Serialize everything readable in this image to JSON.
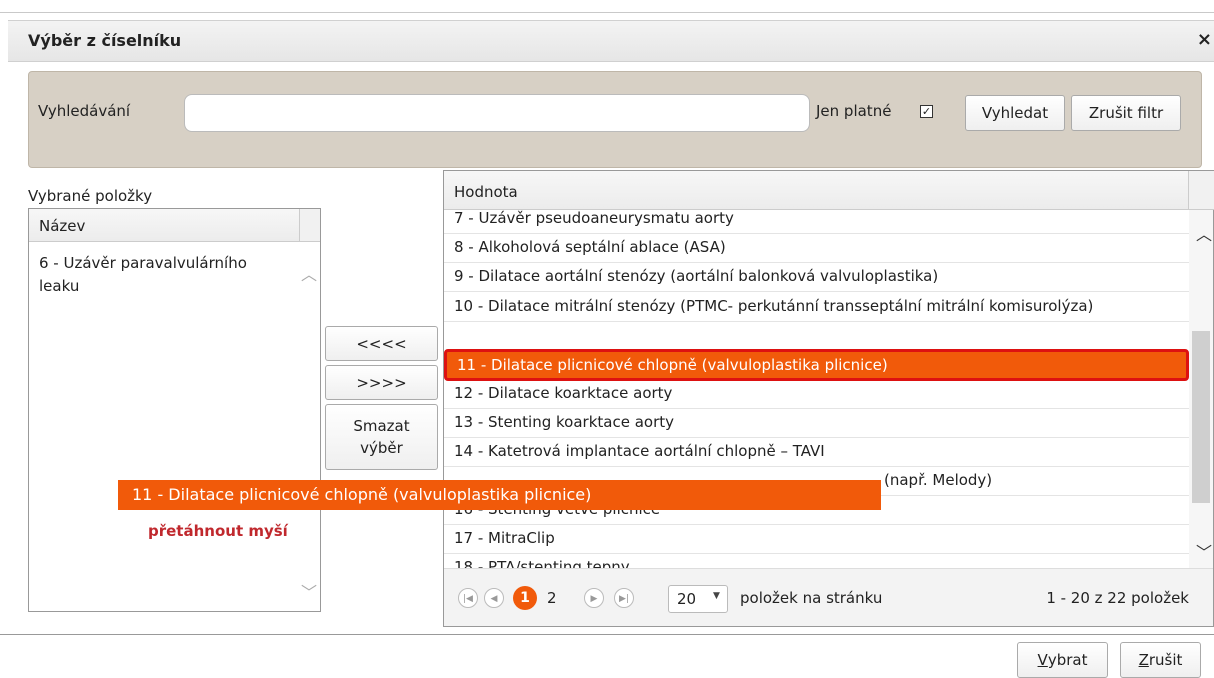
{
  "dialog": {
    "title": "Výběr z číselníku",
    "close_symbol": "×"
  },
  "search": {
    "label": "Vyhledávání",
    "value": "",
    "placeholder": "",
    "only_valid_label": "Jen platné",
    "only_valid_checked": true,
    "search_button": "Vyhledat",
    "clear_filter_button": "Zrušit filtr"
  },
  "selected": {
    "label": "Vybrané položky",
    "column_header": "Název",
    "items": [
      "6 - Uzávěr paravalvulárního leaku"
    ]
  },
  "transfer": {
    "move_left": "<<<<",
    "move_right": ">>>>",
    "clear_selection_line1": "Smazat",
    "clear_selection_line2": "výběr"
  },
  "list": {
    "column_header": "Hodnota",
    "rows": [
      "7 - Uzávěr pseudoaneurysmatu aorty",
      "8 - Alkoholová septální ablace (ASA)",
      "9 - Dilatace aortální stenózy (aortální balonková valvuloplastika)",
      "10 - Dilatace mitrální stenózy (PTMC- perkutánní transseptální mitrální komisurolýza)",
      "11 - Dilatace plicnicové chlopně (valvuloplastika plicnice)",
      "12 - Dilatace koarktace aorty",
      "13 - Stenting koarktace aorty",
      "14 - Katetrová implantace aortální chlopně – TAVI",
      "(např. Melody)",
      "16 - Stenting větve plicnice",
      "17 - MitraClip",
      "18 - PTA/stenting tepny"
    ],
    "highlighted_index": 4
  },
  "drag": {
    "ghost_text": "11 - Dilatace plicnicové chlopně (valvuloplastika plicnice)",
    "hint": "přetáhnout myší"
  },
  "pager": {
    "pages": [
      "1",
      "2"
    ],
    "current_page": "1",
    "page_size": "20",
    "items_per_page_label": "položek na stránku",
    "count_text": "1 - 20 z 22 položek",
    "icons": [
      "first-page-icon",
      "prev-page-icon",
      "next-page-icon",
      "last-page-icon"
    ]
  },
  "footer": {
    "ok_accesskey": "V",
    "ok_rest": "ybrat",
    "cancel_accesskey": "Z",
    "cancel_rest": "rušit"
  },
  "colors": {
    "accent_orange": "#f15a0a",
    "highlight_border": "#dd1111",
    "hint_red": "#c0282d",
    "search_panel_bg": "#d7d0c5"
  }
}
